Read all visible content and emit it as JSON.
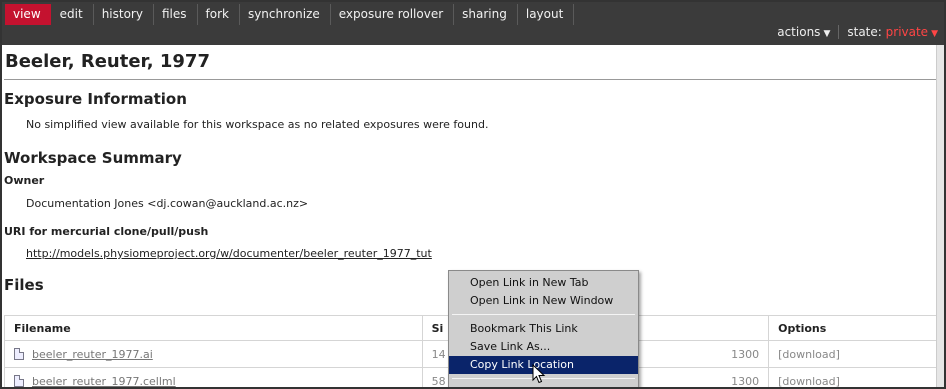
{
  "topbar": {
    "tabs": [
      {
        "label": "view"
      },
      {
        "label": "edit"
      },
      {
        "label": "history"
      },
      {
        "label": "files"
      },
      {
        "label": "fork"
      },
      {
        "label": "synchronize"
      },
      {
        "label": "exposure rollover"
      },
      {
        "label": "sharing"
      },
      {
        "label": "layout"
      }
    ],
    "actions_label": "actions",
    "state_label": "state:",
    "state_value": "private",
    "caret": "▼"
  },
  "page": {
    "title": "Beeler, Reuter, 1977",
    "exposure_heading": "Exposure Information",
    "exposure_text": "No simplified view available for this workspace as no related exposures were found.",
    "summary_heading": "Workspace Summary",
    "owner_label": "Owner",
    "owner_value": "Documentation Jones <dj.cowan@auckland.ac.nz>",
    "uri_label": "URI for mercurial clone/pull/push",
    "uri_value": "http://models.physiomeproject.org/w/documenter/beeler_reuter_1977_tut",
    "files_heading": "Files"
  },
  "files_table": {
    "headers": [
      "Filename",
      "Si",
      "",
      "Options"
    ],
    "rows": [
      {
        "name": "beeler_reuter_1977.ai",
        "size": "14",
        "date": "1300",
        "option": "[download]"
      },
      {
        "name": "beeler_reuter_1977.cellml",
        "size": "58",
        "date": "1300",
        "option": "[download]"
      }
    ]
  },
  "context_menu": {
    "items": [
      {
        "label": "Open Link in New Tab"
      },
      {
        "label": "Open Link in New Window"
      },
      {
        "label": "Bookmark This Link"
      },
      {
        "label": "Save Link As..."
      },
      {
        "label": "Copy Link Location"
      }
    ]
  },
  "colors": {
    "active_tab": "#c4122f",
    "topbar_bg": "#3b3b3b",
    "state_value": "#ff4545",
    "menu_highlight": "#0a246a"
  }
}
